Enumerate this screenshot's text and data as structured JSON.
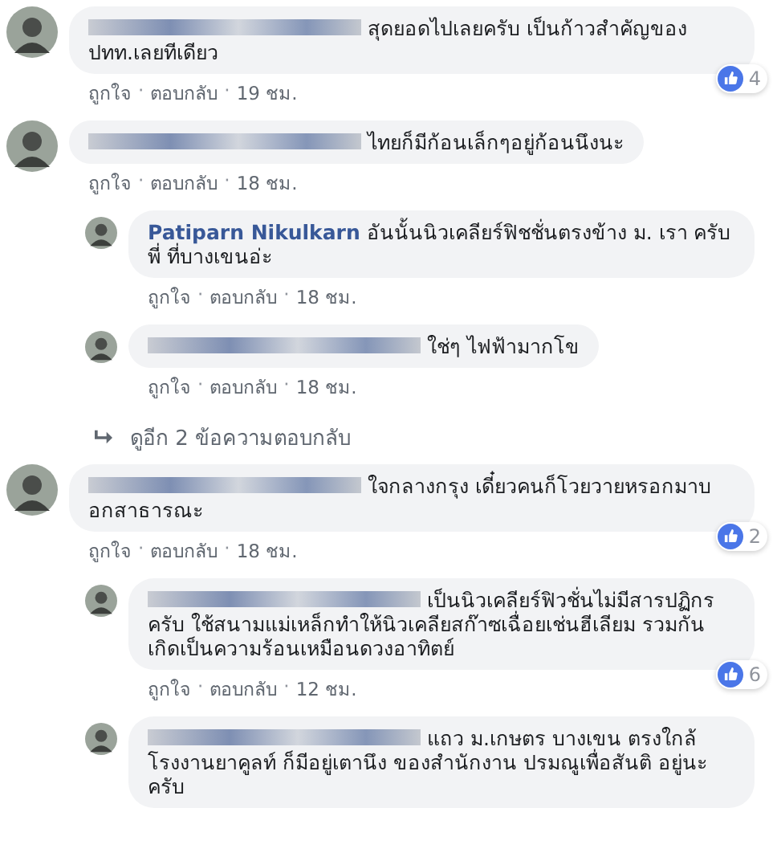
{
  "separator": "·",
  "comments": [
    {
      "kind": "comment",
      "name_blurred": true,
      "text": "สุดยอดไปเลยครับ เป็นก้าวสำคัญของปทท.เลยทีเดียว",
      "likes": "4",
      "actions": [
        "ถูกใจ",
        "ตอบกลับ",
        "19 ชม."
      ]
    },
    {
      "kind": "comment",
      "name_blurred": true,
      "text": "ไทยก็มีก้อนเล็กๆอยู่ก้อนนึงนะ",
      "actions": [
        "ถูกใจ",
        "ตอบกลับ",
        "18 ชม."
      ],
      "children": [
        {
          "kind": "comment",
          "name_blurred": false,
          "text": "**Patiparn Nikulkarn** อันนั้นนิวเคลียร์ฟิชชั่นตรงข้าง ม. เรา ครับพี่ ที่บางเขนอ่ะ",
          "actions": [
            "ถูกใจ",
            "ตอบกลับ",
            "18 ชม."
          ]
        },
        {
          "kind": "comment",
          "name_blurred": true,
          "text": "ใช่ๆ ไฟฟ้ามากโข",
          "actions": [
            "ถูกใจ",
            "ตอบกลับ",
            "18 ชม."
          ]
        },
        {
          "kind": "more",
          "text": "ดูอีก 2 ข้อความตอบกลับ"
        }
      ]
    },
    {
      "kind": "comment",
      "name_blurred": true,
      "text": "ใจกลางกรุง เดี๋ยวคนก็โวยวายหรอกมาบอกสาธารณะ",
      "likes": "2",
      "actions": [
        "ถูกใจ",
        "ตอบกลับ",
        "18 ชม."
      ],
      "children": [
        {
          "kind": "comment",
          "name_blurred": true,
          "text": "เป็นนิวเคลียร์ฟิวชั่นไม่มีสารปฏิกรครับ ใช้สนามแม่เหล็กทำให้นิวเคลียสก๊าซเฉื่อยเช่นฮีเลียม รวมกันเกิดเป็นความร้อนเหมือนดวงอาทิตย์",
          "likes": "6",
          "actions": [
            "ถูกใจ",
            "ตอบกลับ",
            "12 ชม."
          ]
        },
        {
          "kind": "comment",
          "name_blurred": true,
          "text": "แถว ม.เกษตร บางเขน ตรงใกล้โรงงานยาคูลท์ ก็มีอยู่เตานึง ของสำนักงาน ปรมณูเพื่อสันติ อยู่นะครับ"
        }
      ]
    }
  ]
}
